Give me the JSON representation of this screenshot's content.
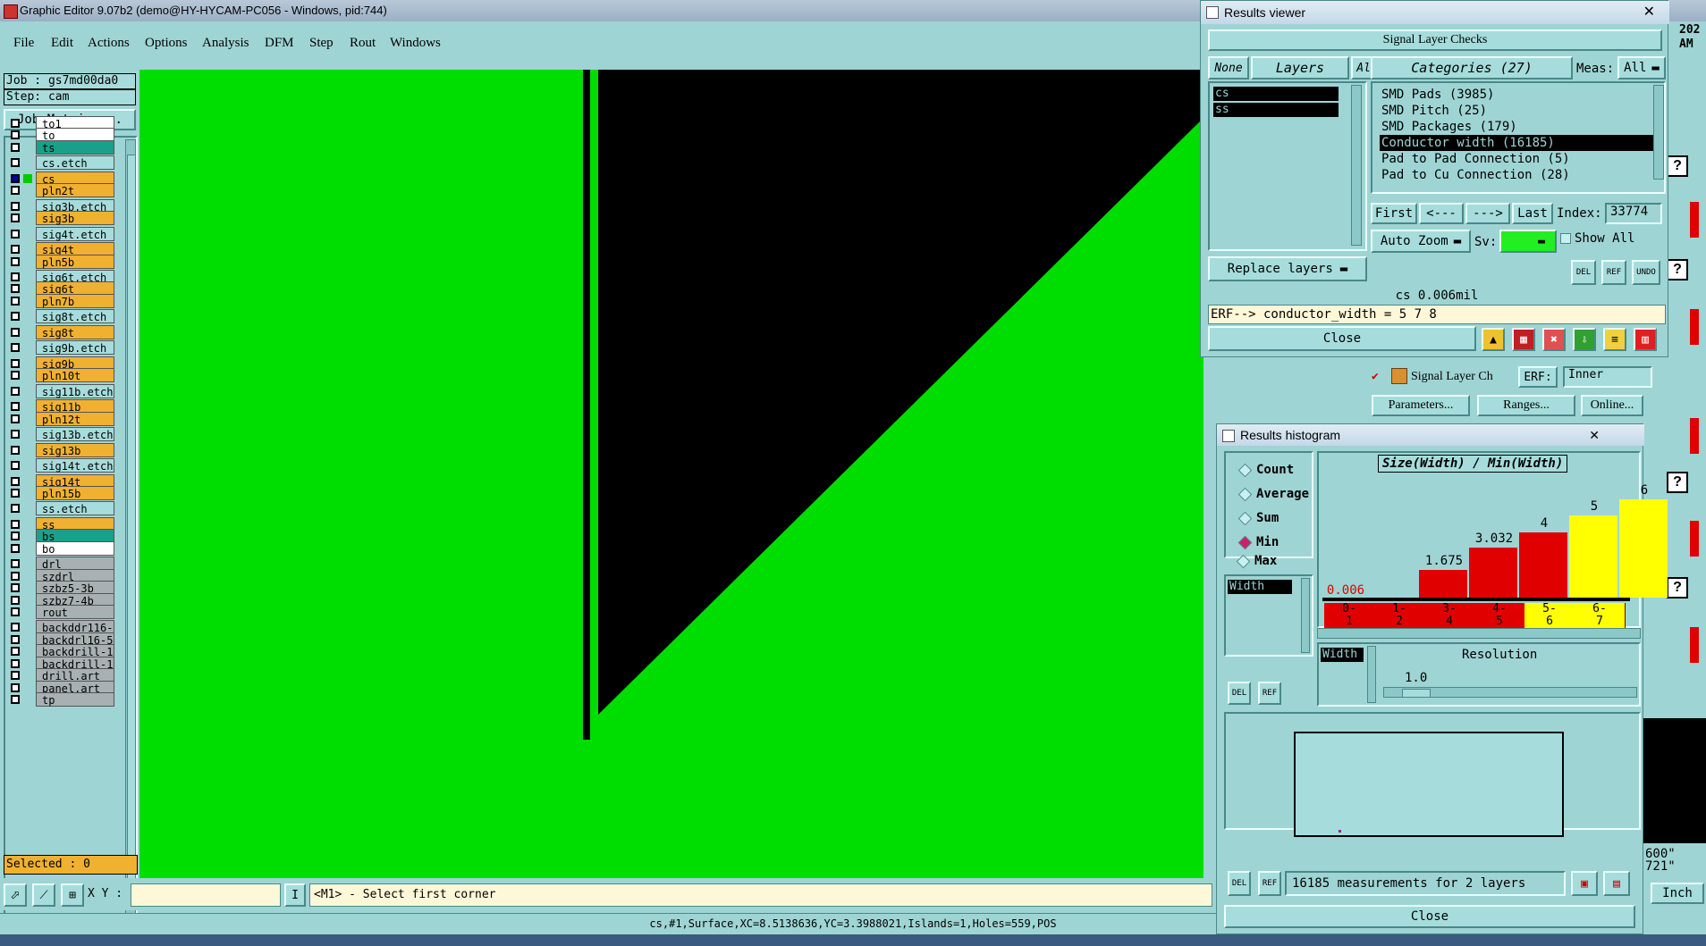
{
  "window": {
    "title": "Graphic Editor 9.07b2 (demo@HY-HYCAM-PC056 - Windows, pid:744)"
  },
  "menu": [
    "File",
    "Edit",
    "Actions",
    "Options",
    "Analysis",
    "DFM",
    "Step",
    "Rout",
    "Windows"
  ],
  "job": {
    "job_line": "Job : gs7md00da0",
    "step_line": "Step: cam",
    "matrix_button": "Job Matrix ..."
  },
  "layers": [
    {
      "name": "to1",
      "color": "#ffffff"
    },
    {
      "name": "to",
      "color": "#ffffff"
    },
    {
      "name": "ts",
      "color": "#1aa08a"
    },
    {
      "name": "cs.etch",
      "color": "#a6dcdc"
    },
    {
      "name": "cs",
      "color": "#f0b030"
    },
    {
      "name": "pln2t",
      "color": "#f0b030"
    },
    {
      "name": "sig3b.etch",
      "color": "#a6dcdc"
    },
    {
      "name": "sig3b",
      "color": "#f0b030"
    },
    {
      "name": "sig4t.etch",
      "color": "#a6dcdc"
    },
    {
      "name": "sig4t",
      "color": "#f0b030"
    },
    {
      "name": "pln5b",
      "color": "#f0b030"
    },
    {
      "name": "sig6t.etch",
      "color": "#a6dcdc"
    },
    {
      "name": "sig6t",
      "color": "#f0b030"
    },
    {
      "name": "pln7b",
      "color": "#f0b030"
    },
    {
      "name": "sig8t.etch",
      "color": "#a6dcdc"
    },
    {
      "name": "sig8t",
      "color": "#f0b030"
    },
    {
      "name": "sig9b.etch",
      "color": "#a6dcdc"
    },
    {
      "name": "sig9b",
      "color": "#f0b030"
    },
    {
      "name": "pln10t",
      "color": "#f0b030"
    },
    {
      "name": "sig11b.etch",
      "color": "#a6dcdc"
    },
    {
      "name": "sig11b",
      "color": "#f0b030"
    },
    {
      "name": "pln12t",
      "color": "#f0b030"
    },
    {
      "name": "sig13b.etch",
      "color": "#a6dcdc"
    },
    {
      "name": "sig13b",
      "color": "#f0b030"
    },
    {
      "name": "sig14t.etch",
      "color": "#a6dcdc"
    },
    {
      "name": "sig14t",
      "color": "#f0b030"
    },
    {
      "name": "pln15b",
      "color": "#f0b030"
    },
    {
      "name": "ss.etch",
      "color": "#a6dcdc"
    },
    {
      "name": "ss",
      "color": "#f0b030"
    },
    {
      "name": "bs",
      "color": "#1aa08a"
    },
    {
      "name": "bo",
      "color": "#ffffff"
    },
    {
      "name": "drl",
      "color": "#a8b0b4"
    },
    {
      "name": "szdrl",
      "color": "#a8b0b4"
    },
    {
      "name": "szbz5-3b",
      "color": "#a8b0b4"
    },
    {
      "name": "szbz7-4b",
      "color": "#a8b0b4"
    },
    {
      "name": "rout",
      "color": "#a8b0b4"
    },
    {
      "name": "backddr116-",
      "color": "#a8b0b4"
    },
    {
      "name": "backdrl16-5",
      "color": "#a8b0b4"
    },
    {
      "name": "backdrill-1",
      "color": "#a8b0b4"
    },
    {
      "name": "backdrill-1",
      "color": "#a8b0b4"
    },
    {
      "name": "drill.art",
      "color": "#a8b0b4"
    },
    {
      "name": "panel.art",
      "color": "#a8b0b4"
    },
    {
      "name": "tp",
      "color": "#a8b0b4"
    }
  ],
  "selected": "Selected : 0",
  "coords": {
    "label": "X Y :",
    "value": "",
    "prompt": "<M1> - Select first corner"
  },
  "status": "cs,#1,Surface,XC=8.5138636,YC=3.3988021,Islands=1,Holes=559,POS",
  "results_viewer": {
    "title": "Results viewer",
    "header": "Signal Layer Checks",
    "none_btn": "None",
    "layers_btn": "Layers",
    "all_btn": "All",
    "layer_items": [
      "cs",
      "ss"
    ],
    "categories_label": "Categories (27)",
    "meas_label": "Meas:",
    "meas_value": "All",
    "categories": [
      "SMD Pads (3985)",
      "SMD Pitch (25)",
      "SMD Packages (179)",
      "Conductor width (16185)",
      "Pad to Pad Connection (5)",
      "Pad to Cu Connection (28)"
    ],
    "selected_category": "Conductor width (16185)",
    "nav": {
      "first": "First",
      "prev": "<---",
      "next": "--->",
      "last": "Last",
      "index_label": "Index:",
      "index_value": "33774"
    },
    "auto_zoom": "Auto Zoom",
    "sv_label": "Sv:",
    "show_all": "Show All",
    "replace_layers": "Replace layers",
    "small_btns": [
      "DEL",
      "REF",
      "UNDO"
    ],
    "info": "cs 0.006mil",
    "erf": "ERF--> conductor_width = 5 7 8",
    "close": "Close"
  },
  "signal_row": {
    "label": "Signal Layer Ch",
    "erf_label": "ERF:",
    "erf_value": "Inner",
    "help": "?",
    "parameters": "Parameters...",
    "ranges": "Ranges...",
    "online": "Online..."
  },
  "histogram": {
    "title": "Results histogram",
    "options": [
      "Count",
      "Average",
      "Sum",
      "Min",
      "Max"
    ],
    "selected_option": "Min",
    "list_item": "Width",
    "chart_title": "Size(Width) / Min(Width)",
    "resolution_label": "Resolution",
    "resolution_value": "1.0",
    "width_label": "Width",
    "summary": "16185 measurements for 2 layers",
    "close": "Close",
    "del": "DEL",
    "ref": "REF"
  },
  "chart_data": {
    "type": "bar",
    "title": "Size(Width) / Min(Width)",
    "categories": [
      "0-1",
      "1-2",
      "3-4",
      "4-5",
      "5-6",
      "6-7"
    ],
    "values": [
      0.006,
      1.675,
      3.032,
      4,
      5,
      6
    ],
    "value_labels": [
      "0.006",
      "1.675",
      "3.032",
      "4",
      "5",
      "6"
    ],
    "colors": [
      "#e00000",
      "#e00000",
      "#e00000",
      "#e00000",
      "#ffff00",
      "#ffff00"
    ],
    "bin_labels": [
      [
        "0-",
        "1"
      ],
      [
        "1-",
        "2"
      ],
      [
        "3-",
        "4"
      ],
      [
        "4-",
        "5"
      ],
      [
        "5-",
        "6"
      ],
      [
        "6-",
        "7"
      ]
    ],
    "ylim": [
      0,
      6
    ]
  },
  "right_side": {
    "help": "?",
    "fragment1": "202",
    "fragment2": "AM",
    "coord1": "600\"",
    "coord2": "721\"",
    "units": "Inch"
  },
  "colors": {
    "canvas_bg": "#00dd00",
    "shape": "#000000",
    "panel": "#9fd4d4",
    "selection": "#000000"
  }
}
